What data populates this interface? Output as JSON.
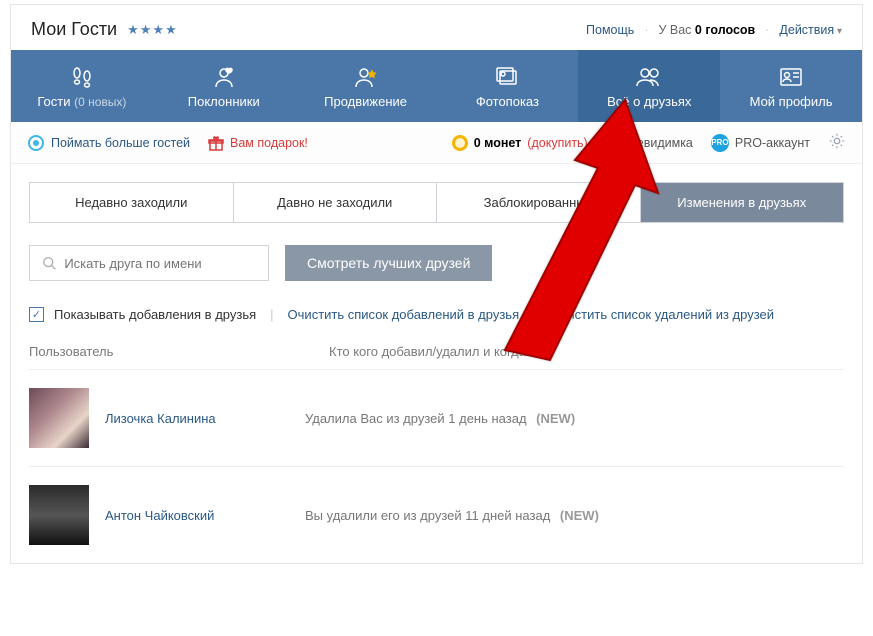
{
  "header": {
    "title": "Мои Гости",
    "stars": "★★★★",
    "help": "Помощь",
    "votes_prefix": "У Вас ",
    "votes_count": "0 голосов",
    "actions": "Действия"
  },
  "nav": {
    "guests": {
      "label": "Гости",
      "sub": "(0 новых)"
    },
    "fans": {
      "label": "Поклонники"
    },
    "promo": {
      "label": "Продвижение"
    },
    "photoshow": {
      "label": "Фотопоказ"
    },
    "friends": {
      "label": "Всё о друзьях"
    },
    "profile": {
      "label": "Мой профиль"
    }
  },
  "util": {
    "catch_more": "Поймать больше гостей",
    "gift": "Вам подарок!",
    "coins_count": "0 монет",
    "buy_more": "(докупить)",
    "invisible": "Невидимка",
    "pro": "PRO-аккаунт"
  },
  "tabs": {
    "recent": "Недавно заходили",
    "old": "Давно не заходили",
    "blocked": "Заблокированные",
    "changes": "Изменения в друзьях"
  },
  "search": {
    "placeholder": "Искать друга по имени",
    "best_btn": "Смотреть лучших друзей"
  },
  "options": {
    "show_adds": "Показывать добавления в друзья",
    "clear_adds": "Очистить список добавлений в друзья",
    "clear_dels": "Очистить список удалений из друзей"
  },
  "list": {
    "header_user": "Пользователь",
    "header_event": "Кто кого добавил/удалил и когда",
    "new_tag": "(NEW)",
    "rows": [
      {
        "name": "Лизочка Калинина",
        "event": "Удалила Вас из друзей 1 день назад"
      },
      {
        "name": "Антон Чайковский",
        "event": "Вы удалили его из друзей 11 дней назад"
      }
    ]
  }
}
